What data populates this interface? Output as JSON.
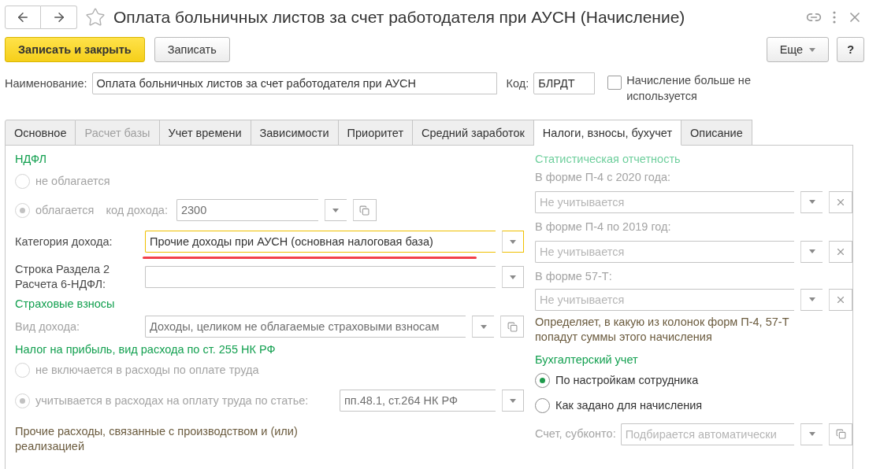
{
  "window": {
    "title": "Оплата больничных листов за счет работодателя при АУСН (Начисление)"
  },
  "toolbar": {
    "buttons": [
      {
        "label": "Записать и закрыть",
        "kind": "primary"
      },
      {
        "label": "Записать",
        "kind": "normal"
      }
    ],
    "more": "Еще",
    "help": "?"
  },
  "header_fields": {
    "name": {
      "label": "Наименование:",
      "value": "Оплата больничных листов за счет работодателя при АУСН"
    },
    "code": {
      "label": "Код:",
      "value": "БЛРДТ"
    },
    "unused": {
      "label": "Начисление больше не используется",
      "checked": false
    }
  },
  "tabs": [
    {
      "label": "Основное",
      "selected": false,
      "disabled": false
    },
    {
      "label": "Расчет базы",
      "selected": false,
      "disabled": true
    },
    {
      "label": "Учет времени",
      "selected": false,
      "disabled": false
    },
    {
      "label": "Зависимости",
      "selected": false,
      "disabled": false
    },
    {
      "label": "Приоритет",
      "selected": false,
      "disabled": false
    },
    {
      "label": "Средний заработок",
      "selected": false,
      "disabled": false
    },
    {
      "label": "Налоги, взносы, бухучет",
      "selected": true,
      "disabled": false
    },
    {
      "label": "Описание",
      "selected": false,
      "disabled": false
    }
  ],
  "ndfl": {
    "title": "НДФЛ",
    "options": [
      {
        "label": "не облагается",
        "selected": false,
        "disabled": true
      },
      {
        "label": "облагается",
        "selected": true,
        "disabled": true
      }
    ],
    "code_label": "код дохода:",
    "code_value": "2300",
    "category": {
      "label": "Категория дохода:",
      "value": "Прочие доходы при АУСН (основная налоговая база)",
      "focused": true,
      "underlined": true
    },
    "line6": {
      "label": "Строка Раздела 2 Расчета 6-НДФЛ:"
    }
  },
  "insurance": {
    "title": "Страховые взносы",
    "label": "Вид дохода:",
    "value": "Доходы, целиком не облагаемые страховыми взносам",
    "disabled": true
  },
  "profit": {
    "title": "Налог на прибыль, вид расхода по ст. 255 НК РФ",
    "options": [
      {
        "label": "не включается в расходы по оплате труда",
        "selected": false,
        "disabled": true
      },
      {
        "label": "учитывается в расходах на оплату труда по статье:",
        "selected": true,
        "disabled": true,
        "value": "пп.48.1, ст.264 НК РФ"
      }
    ],
    "note": "Прочие расходы, связанные с производством и (или) реализацией"
  },
  "statistics": {
    "title": "Статистическая отчетность",
    "disabled": true,
    "fields": [
      {
        "label": "В форме П-4 с 2020 года:",
        "placeholder": "Не учитывается"
      },
      {
        "label": "В форме П-4 по 2019 год:",
        "placeholder": "Не учитывается"
      },
      {
        "label": "В форме 57-Т:",
        "placeholder": "Не учитывается"
      }
    ],
    "note": "Определяет, в какую из колонок форм П-4, 57-Т попадут суммы этого начисления"
  },
  "accounting": {
    "title": "Бухгалтерский учет",
    "options": [
      {
        "label": "По настройкам сотрудника",
        "selected": true,
        "disabled": false
      },
      {
        "label": "Как задано для начисления",
        "selected": false,
        "disabled": false
      }
    ],
    "account": {
      "label": "Счет, субконто:",
      "placeholder": "Подбирается автоматически",
      "disabled": true
    }
  }
}
